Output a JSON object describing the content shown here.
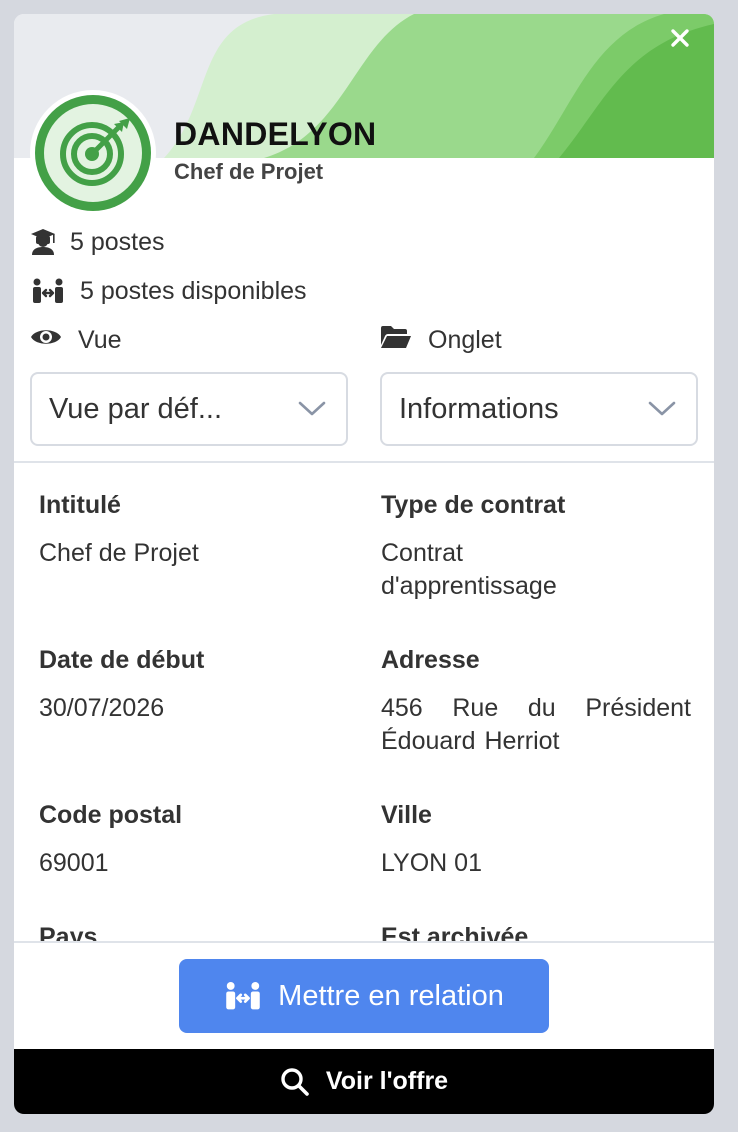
{
  "header": {
    "company_name": "DANDELYON",
    "job_title": "Chef de Projet",
    "close_icon": "close-icon",
    "logo_icon": "target-icon"
  },
  "stats": [
    {
      "icon": "graduate-icon",
      "text": "5 postes"
    },
    {
      "icon": "people-arrows-icon",
      "text": "5 postes disponibles"
    }
  ],
  "selectors": {
    "view": {
      "label": "Vue",
      "icon": "eye-icon",
      "value": "Vue par déf..."
    },
    "tab": {
      "label": "Onglet",
      "icon": "folder-open-icon",
      "value": "Informations"
    }
  },
  "details": [
    {
      "label": "Intitulé",
      "value": "Chef de Projet"
    },
    {
      "label": "Type de contrat",
      "value": "Contrat d'apprentissage"
    },
    {
      "label": "Date de début",
      "value": "30/07/2026"
    },
    {
      "label": "Adresse",
      "value": "456 Rue du Président Édouard Herriot"
    },
    {
      "label": "Code postal",
      "value": "69001"
    },
    {
      "label": "Ville",
      "value": "LYON 01"
    },
    {
      "label": "Pays",
      "value": ""
    },
    {
      "label": "Est archivée",
      "value": ""
    }
  ],
  "actions": {
    "relation_label": "Mettre en relation",
    "offer_label": "Voir l'offre"
  },
  "colors": {
    "accent_blue": "#4f86ee",
    "brand_green": "#43a047",
    "banner_green": "#6cc05a"
  }
}
